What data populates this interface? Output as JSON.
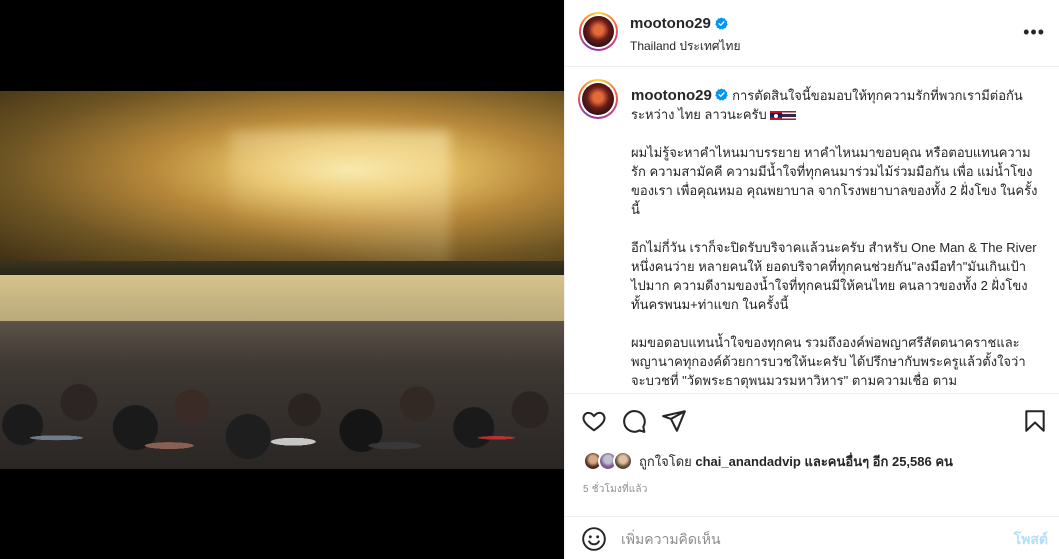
{
  "post": {
    "username": "mootono29",
    "location": "Thailand ประเทศไทย",
    "more_label": "•••"
  },
  "caption": {
    "username": "mootono29",
    "line1": "การตัดสินใจนี้ขอมอบให้ทุกความรักที่พวกเรามีต่อกันระหว่าง ไทย ลาวนะครับ",
    "para1": "ผมไม่รู้จะหาคำไหนมาบรรยาย หาคำไหนมาขอบคุณ หรือตอบแทนความรัก ความสามัคคี ความมีน้ำใจที่ทุกคนมาร่วมไม้ร่วมมือกัน เพื่อ แม่น้ำโขงของเรา เพื่อคุณหมอ คุณพยาบาล จากโรงพยาบาลของทั้ง 2 ฝั่งโขง ในครั้งนี้",
    "para2": "อีกไม่กี่วัน เราก็จะปิดรับบริจาคแล้วนะครับ สำหรับ One Man & The River หนึ่งคนว่าย หลายคนให้ ยอดบริจาคที่ทุกคนช่วยกัน\"ลงมือทำ\"มันเกินเป้าไปมาก ความดีงามของน้ำใจที่ทุกคนมีให้คนไทย คนลาวของทั้ง 2 ฝั่งโขง ทั้นครพนม+ท่าแขก ในครั้งนี้",
    "para3": "ผมขอตอบแทนน้ำใจของทุกคน รวมถึงองค์พ่อพญาศรีสัตตนาคราชและพญานาคทุกองค์ด้วยการบวชให้นะครับ ได้ปรึกษากับพระครูแล้วตั้งใจว่าจะบวชที่ \"วัดพระธาตุพนมวรมหาวิหาร\" ตามความเชื่อ ตาม"
  },
  "likes": {
    "prefix": "ถูกใจโดย",
    "user": "chai_anandadvip",
    "and_others": "และคนอื่นๆ อีก 25,586 คน"
  },
  "timestamp": "5 ชั่วโมงที่แล้ว",
  "comment": {
    "placeholder": "เพิ่มความคิดเห็น",
    "post_label": "โพสต์"
  },
  "icons": [
    "heart-icon",
    "comment-icon",
    "share-icon",
    "bookmark-icon",
    "emoji-icon",
    "verified-icon",
    "more-icon"
  ],
  "colors": {
    "verified": "#0095f6",
    "post_button": "#b2dffc",
    "muted": "#8e8e8e"
  }
}
